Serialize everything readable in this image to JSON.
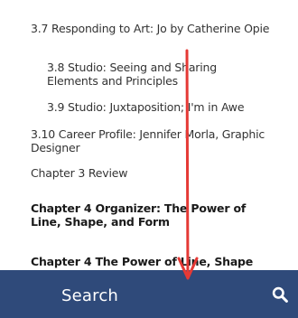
{
  "toc": {
    "items": [
      {
        "label": "3.7 Responding to Art: Jo by Catherine Opie"
      },
      {
        "label": "3.8 Studio: Seeing and Sharing Elements and Principles"
      },
      {
        "label": "3.9 Studio: Juxtaposition; I'm in Awe"
      },
      {
        "label": "3.10 Career Profile: Jennifer Morla, Graphic Designer"
      },
      {
        "label": "Chapter 3 Review"
      },
      {
        "label": "Chapter 4 Organizer: The Power of Line, Shape, and Form"
      },
      {
        "label": "Chapter 4 The Power of Line, Shape"
      }
    ]
  },
  "search_bar": {
    "label": "Search",
    "icon": "search-icon",
    "background_color": "#2f4a7a"
  },
  "annotation": {
    "icon": "arrow-down-icon",
    "color": "#e53935"
  }
}
